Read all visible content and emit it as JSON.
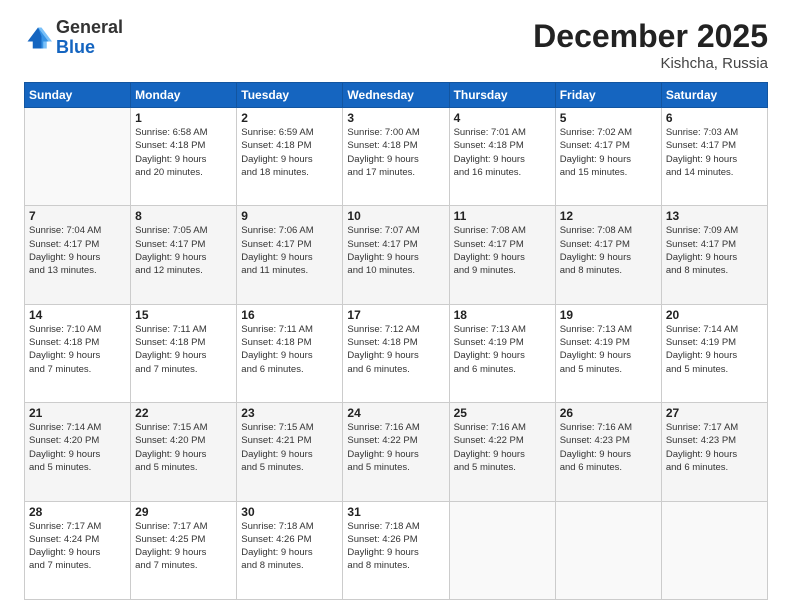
{
  "header": {
    "logo_general": "General",
    "logo_blue": "Blue",
    "month": "December 2025",
    "location": "Kishcha, Russia"
  },
  "weekdays": [
    "Sunday",
    "Monday",
    "Tuesday",
    "Wednesday",
    "Thursday",
    "Friday",
    "Saturday"
  ],
  "weeks": [
    [
      {
        "day": "",
        "info": ""
      },
      {
        "day": "1",
        "info": "Sunrise: 6:58 AM\nSunset: 4:18 PM\nDaylight: 9 hours\nand 20 minutes."
      },
      {
        "day": "2",
        "info": "Sunrise: 6:59 AM\nSunset: 4:18 PM\nDaylight: 9 hours\nand 18 minutes."
      },
      {
        "day": "3",
        "info": "Sunrise: 7:00 AM\nSunset: 4:18 PM\nDaylight: 9 hours\nand 17 minutes."
      },
      {
        "day": "4",
        "info": "Sunrise: 7:01 AM\nSunset: 4:18 PM\nDaylight: 9 hours\nand 16 minutes."
      },
      {
        "day": "5",
        "info": "Sunrise: 7:02 AM\nSunset: 4:17 PM\nDaylight: 9 hours\nand 15 minutes."
      },
      {
        "day": "6",
        "info": "Sunrise: 7:03 AM\nSunset: 4:17 PM\nDaylight: 9 hours\nand 14 minutes."
      }
    ],
    [
      {
        "day": "7",
        "info": "Sunrise: 7:04 AM\nSunset: 4:17 PM\nDaylight: 9 hours\nand 13 minutes."
      },
      {
        "day": "8",
        "info": "Sunrise: 7:05 AM\nSunset: 4:17 PM\nDaylight: 9 hours\nand 12 minutes."
      },
      {
        "day": "9",
        "info": "Sunrise: 7:06 AM\nSunset: 4:17 PM\nDaylight: 9 hours\nand 11 minutes."
      },
      {
        "day": "10",
        "info": "Sunrise: 7:07 AM\nSunset: 4:17 PM\nDaylight: 9 hours\nand 10 minutes."
      },
      {
        "day": "11",
        "info": "Sunrise: 7:08 AM\nSunset: 4:17 PM\nDaylight: 9 hours\nand 9 minutes."
      },
      {
        "day": "12",
        "info": "Sunrise: 7:08 AM\nSunset: 4:17 PM\nDaylight: 9 hours\nand 8 minutes."
      },
      {
        "day": "13",
        "info": "Sunrise: 7:09 AM\nSunset: 4:17 PM\nDaylight: 9 hours\nand 8 minutes."
      }
    ],
    [
      {
        "day": "14",
        "info": "Sunrise: 7:10 AM\nSunset: 4:18 PM\nDaylight: 9 hours\nand 7 minutes."
      },
      {
        "day": "15",
        "info": "Sunrise: 7:11 AM\nSunset: 4:18 PM\nDaylight: 9 hours\nand 7 minutes."
      },
      {
        "day": "16",
        "info": "Sunrise: 7:11 AM\nSunset: 4:18 PM\nDaylight: 9 hours\nand 6 minutes."
      },
      {
        "day": "17",
        "info": "Sunrise: 7:12 AM\nSunset: 4:18 PM\nDaylight: 9 hours\nand 6 minutes."
      },
      {
        "day": "18",
        "info": "Sunrise: 7:13 AM\nSunset: 4:19 PM\nDaylight: 9 hours\nand 6 minutes."
      },
      {
        "day": "19",
        "info": "Sunrise: 7:13 AM\nSunset: 4:19 PM\nDaylight: 9 hours\nand 5 minutes."
      },
      {
        "day": "20",
        "info": "Sunrise: 7:14 AM\nSunset: 4:19 PM\nDaylight: 9 hours\nand 5 minutes."
      }
    ],
    [
      {
        "day": "21",
        "info": "Sunrise: 7:14 AM\nSunset: 4:20 PM\nDaylight: 9 hours\nand 5 minutes."
      },
      {
        "day": "22",
        "info": "Sunrise: 7:15 AM\nSunset: 4:20 PM\nDaylight: 9 hours\nand 5 minutes."
      },
      {
        "day": "23",
        "info": "Sunrise: 7:15 AM\nSunset: 4:21 PM\nDaylight: 9 hours\nand 5 minutes."
      },
      {
        "day": "24",
        "info": "Sunrise: 7:16 AM\nSunset: 4:22 PM\nDaylight: 9 hours\nand 5 minutes."
      },
      {
        "day": "25",
        "info": "Sunrise: 7:16 AM\nSunset: 4:22 PM\nDaylight: 9 hours\nand 5 minutes."
      },
      {
        "day": "26",
        "info": "Sunrise: 7:16 AM\nSunset: 4:23 PM\nDaylight: 9 hours\nand 6 minutes."
      },
      {
        "day": "27",
        "info": "Sunrise: 7:17 AM\nSunset: 4:23 PM\nDaylight: 9 hours\nand 6 minutes."
      }
    ],
    [
      {
        "day": "28",
        "info": "Sunrise: 7:17 AM\nSunset: 4:24 PM\nDaylight: 9 hours\nand 7 minutes."
      },
      {
        "day": "29",
        "info": "Sunrise: 7:17 AM\nSunset: 4:25 PM\nDaylight: 9 hours\nand 7 minutes."
      },
      {
        "day": "30",
        "info": "Sunrise: 7:18 AM\nSunset: 4:26 PM\nDaylight: 9 hours\nand 8 minutes."
      },
      {
        "day": "31",
        "info": "Sunrise: 7:18 AM\nSunset: 4:26 PM\nDaylight: 9 hours\nand 8 minutes."
      },
      {
        "day": "",
        "info": ""
      },
      {
        "day": "",
        "info": ""
      },
      {
        "day": "",
        "info": ""
      }
    ]
  ]
}
